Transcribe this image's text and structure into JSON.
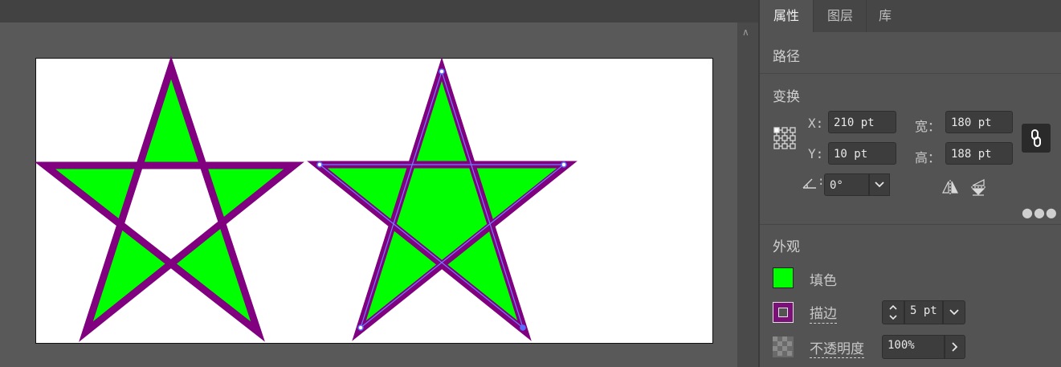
{
  "panel": {
    "tabs": [
      {
        "label": "属性",
        "active": true
      },
      {
        "label": "图层",
        "active": false
      },
      {
        "label": "库",
        "active": false
      }
    ],
    "object_type": "路径",
    "transform": {
      "title": "变换",
      "x_label": "X:",
      "x_value": "210 pt",
      "y_label": "Y:",
      "y_value": "10 pt",
      "width_label": "宽：",
      "width_value": "180 pt",
      "height_label": "高：",
      "height_value": "188 pt",
      "angle_label": ":",
      "angle_value": "0°"
    },
    "appearance": {
      "title": "外观",
      "fill_label": "填色",
      "fill_color": "#00ff00",
      "stroke_label": "描边",
      "stroke_color": "#7a1078",
      "stroke_weight": "5 pt",
      "opacity_label": "不透明度",
      "opacity_value": "100%"
    }
  },
  "canvas": {
    "artboard_color": "#ffffff",
    "stars": [
      {
        "fill": "#00ff00",
        "stroke": "#800080",
        "selected": false
      },
      {
        "fill": "#00ff00",
        "stroke": "#800080",
        "selected": true
      }
    ]
  },
  "icons": {
    "reference_point": "reference-point-grid-icon",
    "link": "link-icon",
    "flip_h": "flip-horizontal-icon",
    "flip_v": "flip-vertical-icon",
    "more": "more-options-icon",
    "scroll_up": "chevron-up-icon"
  }
}
